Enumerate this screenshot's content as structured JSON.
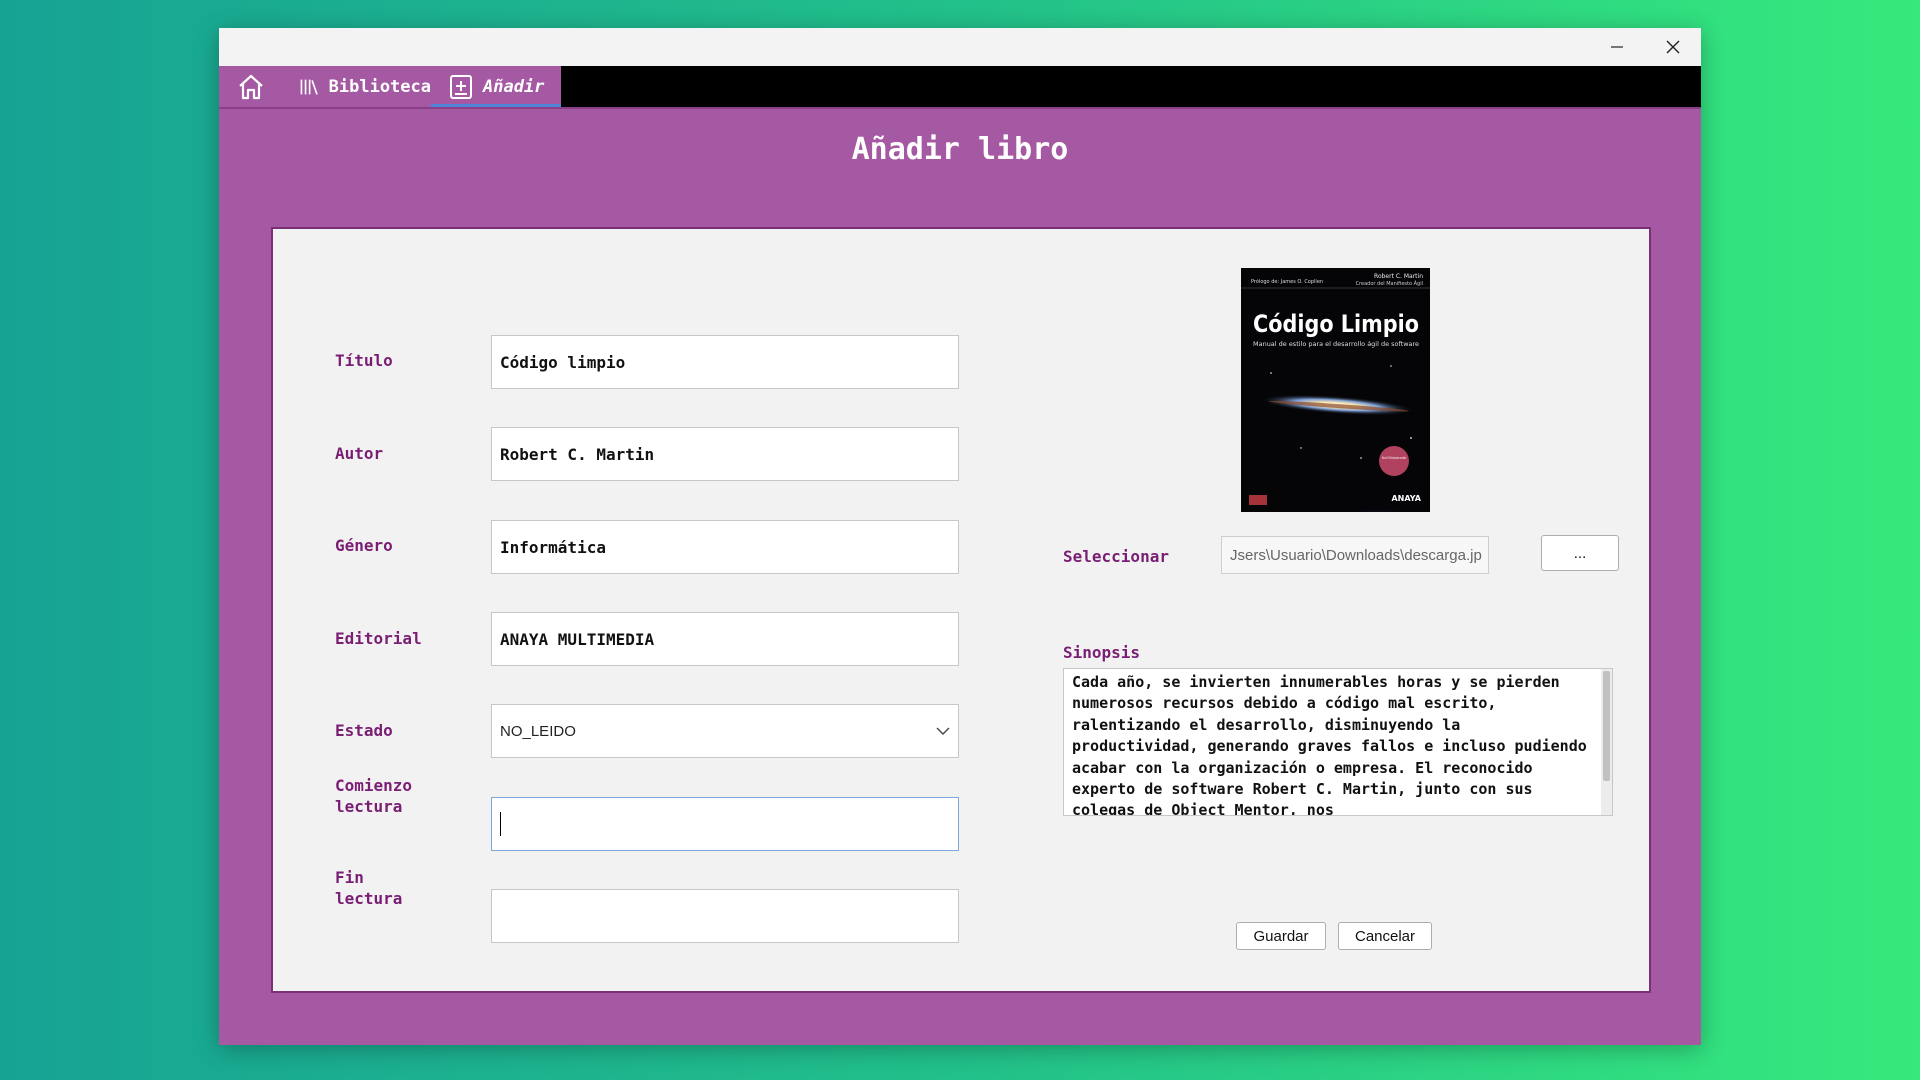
{
  "nav": {
    "home_icon": "home-icon",
    "items": [
      {
        "label": "Biblioteca",
        "icon": "books-icon"
      },
      {
        "label": "Añadir",
        "icon": "add-box-icon"
      }
    ]
  },
  "page": {
    "title": "Añadir libro"
  },
  "form": {
    "titulo": {
      "label": "Título",
      "value": "Código limpio"
    },
    "autor": {
      "label": "Autor",
      "value": "Robert C. Martin"
    },
    "genero": {
      "label": "Género",
      "value": "Informática"
    },
    "editorial": {
      "label": "Editorial",
      "value": "ANAYA MULTIMEDIA"
    },
    "estado": {
      "label": "Estado",
      "value": "NO_LEIDO"
    },
    "comienzo": {
      "label_line1": "Comienzo",
      "label_line2": "lectura",
      "value": ""
    },
    "fin": {
      "label_line1": "Fin",
      "label_line2": "lectura",
      "value": ""
    }
  },
  "image": {
    "seleccionar_label": "Seleccionar",
    "path": "Jsers\\Usuario\\Downloads\\descarga.jp",
    "browse_label": "...",
    "cover": {
      "top_left": "Prólogo de: James O. Coplien",
      "top_right1": "Robert C. Martin",
      "top_right2": "Creador del Manifiesto Ágil",
      "title": "Código Limpio",
      "subtitle": "Manual de estilo para el desarrollo ágil de software",
      "badge": "Más de 70 000 ejemplares vendidos",
      "publisher": "ANAYA"
    }
  },
  "synopsis": {
    "label": "Sinopsis",
    "text": "Cada año, se invierten innumerables horas y se pierden numerosos recursos debido a código mal escrito, ralentizando el desarrollo, disminuyendo la productividad, generando graves fallos e incluso pudiendo acabar con la organización o empresa. El reconocido experto de software Robert C. Martin, junto con sus colegas de Object Mentor, nos"
  },
  "actions": {
    "save": "Guardar",
    "cancel": "Cancelar"
  },
  "colors": {
    "accent": "#a659a3",
    "label": "#7a1e74",
    "menubar": "#000000",
    "tab_underline": "#4f84d8"
  }
}
